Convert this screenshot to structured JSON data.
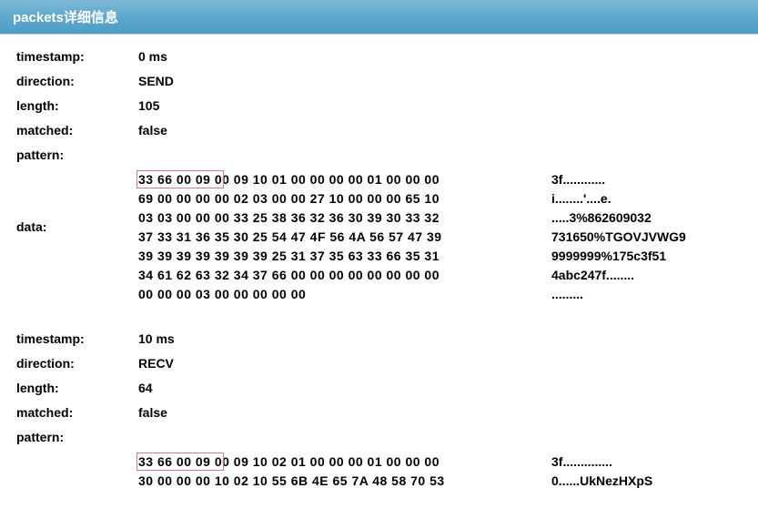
{
  "header": {
    "title": "packets详细信息"
  },
  "labels": {
    "timestamp": "timestamp:",
    "direction": "direction:",
    "length": "length:",
    "matched": "matched:",
    "pattern": "pattern:",
    "data": "data:"
  },
  "packets": [
    {
      "timestamp": "0 ms",
      "direction": "SEND",
      "length": "105",
      "matched": "false",
      "pattern": "",
      "hex": [
        "33 66 00 09 00 09 10 01 00 00 00 00 01 00 00 00",
        "69 00 00 00 00 02 03 00 00 27 10 00 00 00 65 10",
        "03 03 00 00 00 33 25 38 36 32 36 30 39 30 33 32",
        "37 33 31 36 35 30 25 54 47 4F 56 4A 56 57 47 39",
        "39 39 39 39 39 39 39 25 31 37 35 63 33 66 35 31",
        "34 61 62 63 32 34 37 66 00 00 00 00 00 00 00 00",
        "00 00 00 03 00 00 00 00 00"
      ],
      "ascii": [
        "3f............",
        "i........'....e.",
        ".....3%862609032",
        "731650%TGOVJVWG9",
        "9999999%175c3f51",
        "4abc247f........",
        "........."
      ]
    },
    {
      "timestamp": "10 ms",
      "direction": "RECV",
      "length": "64",
      "matched": "false",
      "pattern": "",
      "hex": [
        "33 66 00 09 00 09 10 02 01 00 00 00 01 00 00 00",
        "30 00 00 00 10 02 10 55 6B 4E 65 7A 48 58 70 53"
      ],
      "ascii": [
        "3f..............",
        "0......UkNezHXpS"
      ]
    }
  ]
}
